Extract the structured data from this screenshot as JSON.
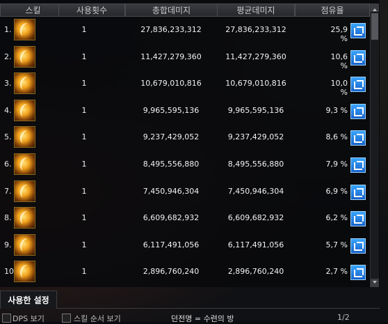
{
  "header": {
    "skill": "스킬",
    "count": "사용횟수",
    "total": "총합데미지",
    "avg": "평균데미지",
    "share": "점유율"
  },
  "rows": [
    {
      "rank": "1.",
      "count": "1",
      "total": "27,836,233,312",
      "avg": "27,836,233,312",
      "pct": "25,9 %"
    },
    {
      "rank": "2.",
      "count": "1",
      "total": "11,427,279,360",
      "avg": "11,427,279,360",
      "pct": "10,6 %"
    },
    {
      "rank": "3.",
      "count": "1",
      "total": "10,679,010,816",
      "avg": "10,679,010,816",
      "pct": "10,0 %"
    },
    {
      "rank": "4.",
      "count": "1",
      "total": "9,965,595,136",
      "avg": "9,965,595,136",
      "pct": "9,3 %"
    },
    {
      "rank": "5.",
      "count": "1",
      "total": "9,237,429,052",
      "avg": "9,237,429,052",
      "pct": "8,6 %"
    },
    {
      "rank": "6.",
      "count": "1",
      "total": "8,495,556,880",
      "avg": "8,495,556,880",
      "pct": "7,9 %"
    },
    {
      "rank": "7.",
      "count": "1",
      "total": "7,450,946,304",
      "avg": "7,450,946,304",
      "pct": "6,9 %"
    },
    {
      "rank": "8.",
      "count": "1",
      "total": "6,609,682,932",
      "avg": "6,609,682,932",
      "pct": "6,2 %"
    },
    {
      "rank": "9.",
      "count": "1",
      "total": "6,117,491,056",
      "avg": "6,117,491,056",
      "pct": "5,7 %"
    },
    {
      "rank": "10.",
      "count": "1",
      "total": "2,896,760,240",
      "avg": "2,896,760,240",
      "pct": "2,7 %"
    }
  ],
  "tab": {
    "label": "사용한 설정"
  },
  "bottom": {
    "dps": "DPS 보기",
    "order": "스킬 순서 보기",
    "dungeon": "던전명 = 수련의 방",
    "page": "1/2"
  },
  "icons": {
    "skill": "skill-icon",
    "share": "share-icon"
  }
}
